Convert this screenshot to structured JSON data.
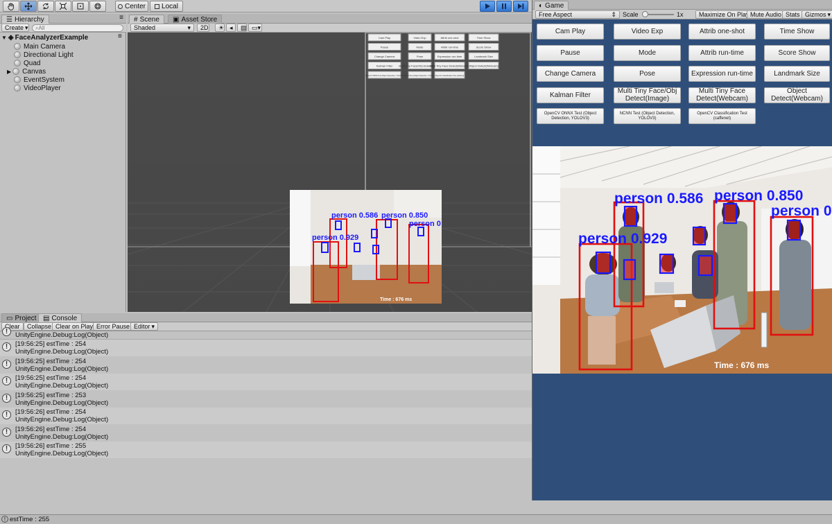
{
  "toolbar": {
    "tools": [
      "hand-tool",
      "move-tool",
      "rotate-tool",
      "scale-tool",
      "rect-tool",
      "transform-tool"
    ],
    "pivot_label": "Center",
    "space_label": "Local"
  },
  "hierarchy": {
    "tab_label": "Hierarchy",
    "create_label": "Create",
    "search_placeholder": "All",
    "scene_name": "FaceAnalyzerExample",
    "items": [
      "Main Camera",
      "Directional Light",
      "Quad",
      "Canvas",
      "EventSystem",
      "VideoPlayer"
    ]
  },
  "scene": {
    "tab_scene": "Scene",
    "tab_asset_store": "Asset Store",
    "shading_mode": "Shaded",
    "mode_2d": "2D"
  },
  "console": {
    "tab_project": "Project",
    "tab_console": "Console",
    "buttons": [
      "Clear",
      "Collapse",
      "Clear on Play",
      "Error Pause",
      "Editor"
    ],
    "top_partial": "UnityEngine.Debug:Log(Object)",
    "logs": [
      {
        "line1": "[19:56:25] estTime : 254",
        "line2": "UnityEngine.Debug:Log(Object)"
      },
      {
        "line1": "[19:56:25] estTime : 254",
        "line2": "UnityEngine.Debug:Log(Object)"
      },
      {
        "line1": "[19:56:25] estTime : 254",
        "line2": "UnityEngine.Debug:Log(Object)"
      },
      {
        "line1": "[19:56:25] estTime : 253",
        "line2": "UnityEngine.Debug:Log(Object)"
      },
      {
        "line1": "[19:56:26] estTime : 254",
        "line2": "UnityEngine.Debug:Log(Object)"
      },
      {
        "line1": "[19:56:26] estTime : 254",
        "line2": "UnityEngine.Debug:Log(Object)"
      },
      {
        "line1": "[19:56:26] estTime : 255",
        "line2": "UnityEngine.Debug:Log(Object)"
      }
    ]
  },
  "game": {
    "tab_label": "Game",
    "aspect": "Free Aspect",
    "scale_label": "Scale",
    "scale_value": "1x",
    "options": [
      "Maximize On Play",
      "Mute Audio",
      "Stats",
      "Gizmos"
    ],
    "buttons": [
      {
        "label": "Cam Play",
        "small": false
      },
      {
        "label": "Video Exp",
        "small": false
      },
      {
        "label": "Attrib one-shot",
        "small": false
      },
      {
        "label": "Time Show",
        "small": false
      },
      {
        "label": "Pause",
        "small": false
      },
      {
        "label": "Mode",
        "small": false
      },
      {
        "label": "Attrib run-time",
        "small": false
      },
      {
        "label": "Score Show",
        "small": false
      },
      {
        "label": "Change Camera",
        "small": false
      },
      {
        "label": "Pose",
        "small": false
      },
      {
        "label": "Expression run-time",
        "small": false
      },
      {
        "label": "Landmark Size",
        "small": false
      },
      {
        "label": "Kalman Filter",
        "small": false
      },
      {
        "label": "Multi Tiny Face/Obj Detect(Image)",
        "small": false
      },
      {
        "label": "Multi Tiny Face Detect(Webcam)",
        "small": false
      },
      {
        "label": "Object Detect(Webcam)",
        "small": false
      },
      {
        "label": "OpenCV ONNX Test (Object Detection, YOLOV3)",
        "small": true
      },
      {
        "label": "NCNN Test (Object Detection, YOLOV3)",
        "small": true
      },
      {
        "label": "OpenCV Classification Test (caffenet)",
        "small": true
      }
    ],
    "detections": [
      {
        "label": "person 0.929"
      },
      {
        "label": "person 0.586"
      },
      {
        "label": "person 0.850"
      },
      {
        "label": "person 0"
      }
    ],
    "time_text": "Time : 676 ms"
  },
  "status": {
    "text": "estTime : 255"
  },
  "colors": {
    "box": "#e01010",
    "label": "#1a1aff",
    "game_bg": "#2f4f7a",
    "play_active": "#3a7fd6"
  }
}
